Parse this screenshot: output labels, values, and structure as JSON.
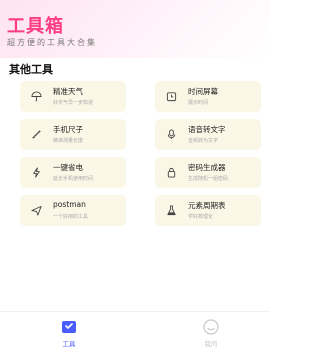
{
  "header": {
    "title": "工具箱",
    "subtitle": "超方便的工具大合集"
  },
  "section": {
    "title": "其他工具"
  },
  "tools": [
    {
      "name": "精准天气",
      "desc": "好天气早一步知道",
      "icon": "umbrella-icon"
    },
    {
      "name": "时间屏幕",
      "desc": "展示时间",
      "icon": "clock-icon"
    },
    {
      "name": "手机尺子",
      "desc": "精准测量长度",
      "icon": "ruler-icon"
    },
    {
      "name": "语音转文字",
      "desc": "音频转为文字",
      "icon": "microphone-icon"
    },
    {
      "name": "一键省电",
      "desc": "延长手机使用时间",
      "icon": "lightning-icon"
    },
    {
      "name": "密码生成器",
      "desc": "生成随机一组密码",
      "icon": "lock-icon"
    },
    {
      "name": "postman",
      "desc": "一个好用的工具",
      "icon": "send-icon"
    },
    {
      "name": "元素周期表",
      "desc": "学好数理化",
      "icon": "flask-icon"
    }
  ],
  "tabbar": {
    "tabs": [
      {
        "label": "工具",
        "icon": "toolbox-icon",
        "active": true
      },
      {
        "label": "我的",
        "icon": "smiley-icon",
        "active": false
      }
    ]
  },
  "colors": {
    "accent": "#ff3d84",
    "tab_active": "#4b5cff",
    "tab_inactive": "#c8c8c8",
    "card_bg": "#fbf7e7"
  }
}
